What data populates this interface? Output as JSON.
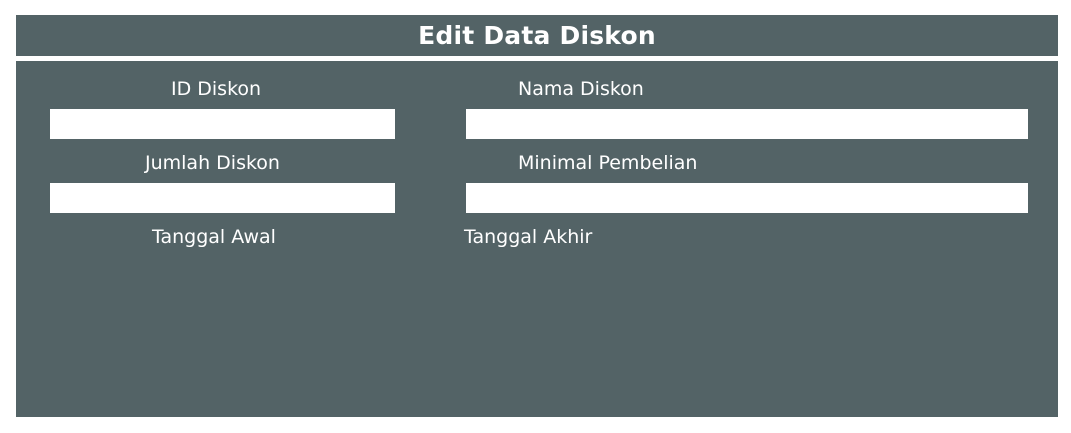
{
  "header": {
    "title": "Edit Data Diskon"
  },
  "form": {
    "id_diskon": {
      "label": "ID Diskon",
      "value": ""
    },
    "nama_diskon": {
      "label": "Nama Diskon",
      "value": ""
    },
    "jumlah_diskon": {
      "label": "Jumlah Diskon",
      "value": ""
    },
    "minimal_pembelian": {
      "label": "Minimal Pembelian",
      "value": ""
    },
    "tanggal_awal": {
      "label": "Tanggal Awal"
    },
    "tanggal_akhir": {
      "label": "Tanggal Akhir"
    }
  },
  "colors": {
    "panel_bg": "#536366",
    "text": "#ffffff",
    "input_bg": "#ffffff",
    "page_bg": "#ffffff"
  }
}
